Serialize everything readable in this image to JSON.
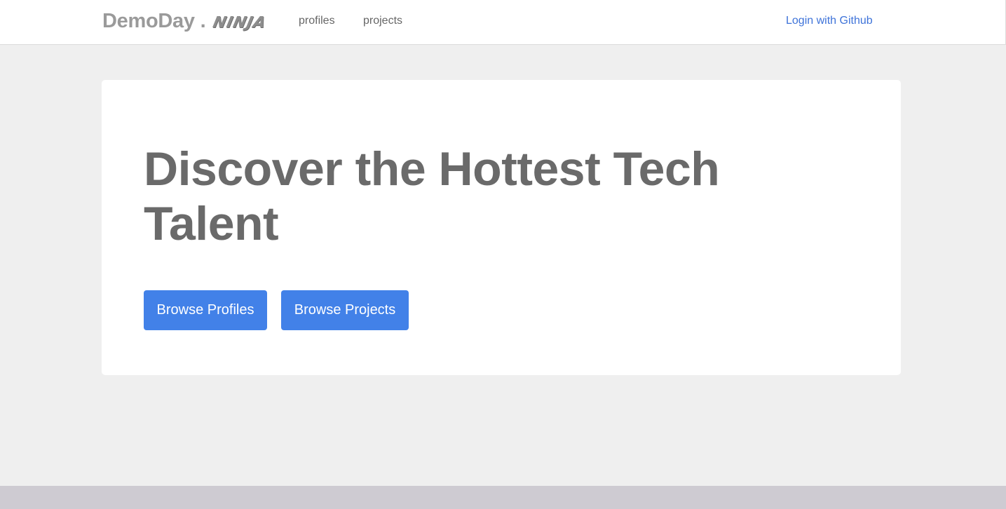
{
  "navbar": {
    "brand_main": "DemoDay",
    "brand_dot": ".",
    "brand_ninja": "NINJA",
    "links": [
      {
        "label": "profiles"
      },
      {
        "label": "projects"
      }
    ],
    "login_label": "Login with Github"
  },
  "hero": {
    "title": "Discover the Hottest Tech Talent",
    "buttons": [
      {
        "label": "Browse Profiles"
      },
      {
        "label": "Browse Projects"
      }
    ]
  },
  "colors": {
    "page_background": "#efefef",
    "button_primary": "#4281e8",
    "link_accent": "#3e73d9",
    "footer": "#cecbd2",
    "heading_text": "#6a6a6a"
  }
}
